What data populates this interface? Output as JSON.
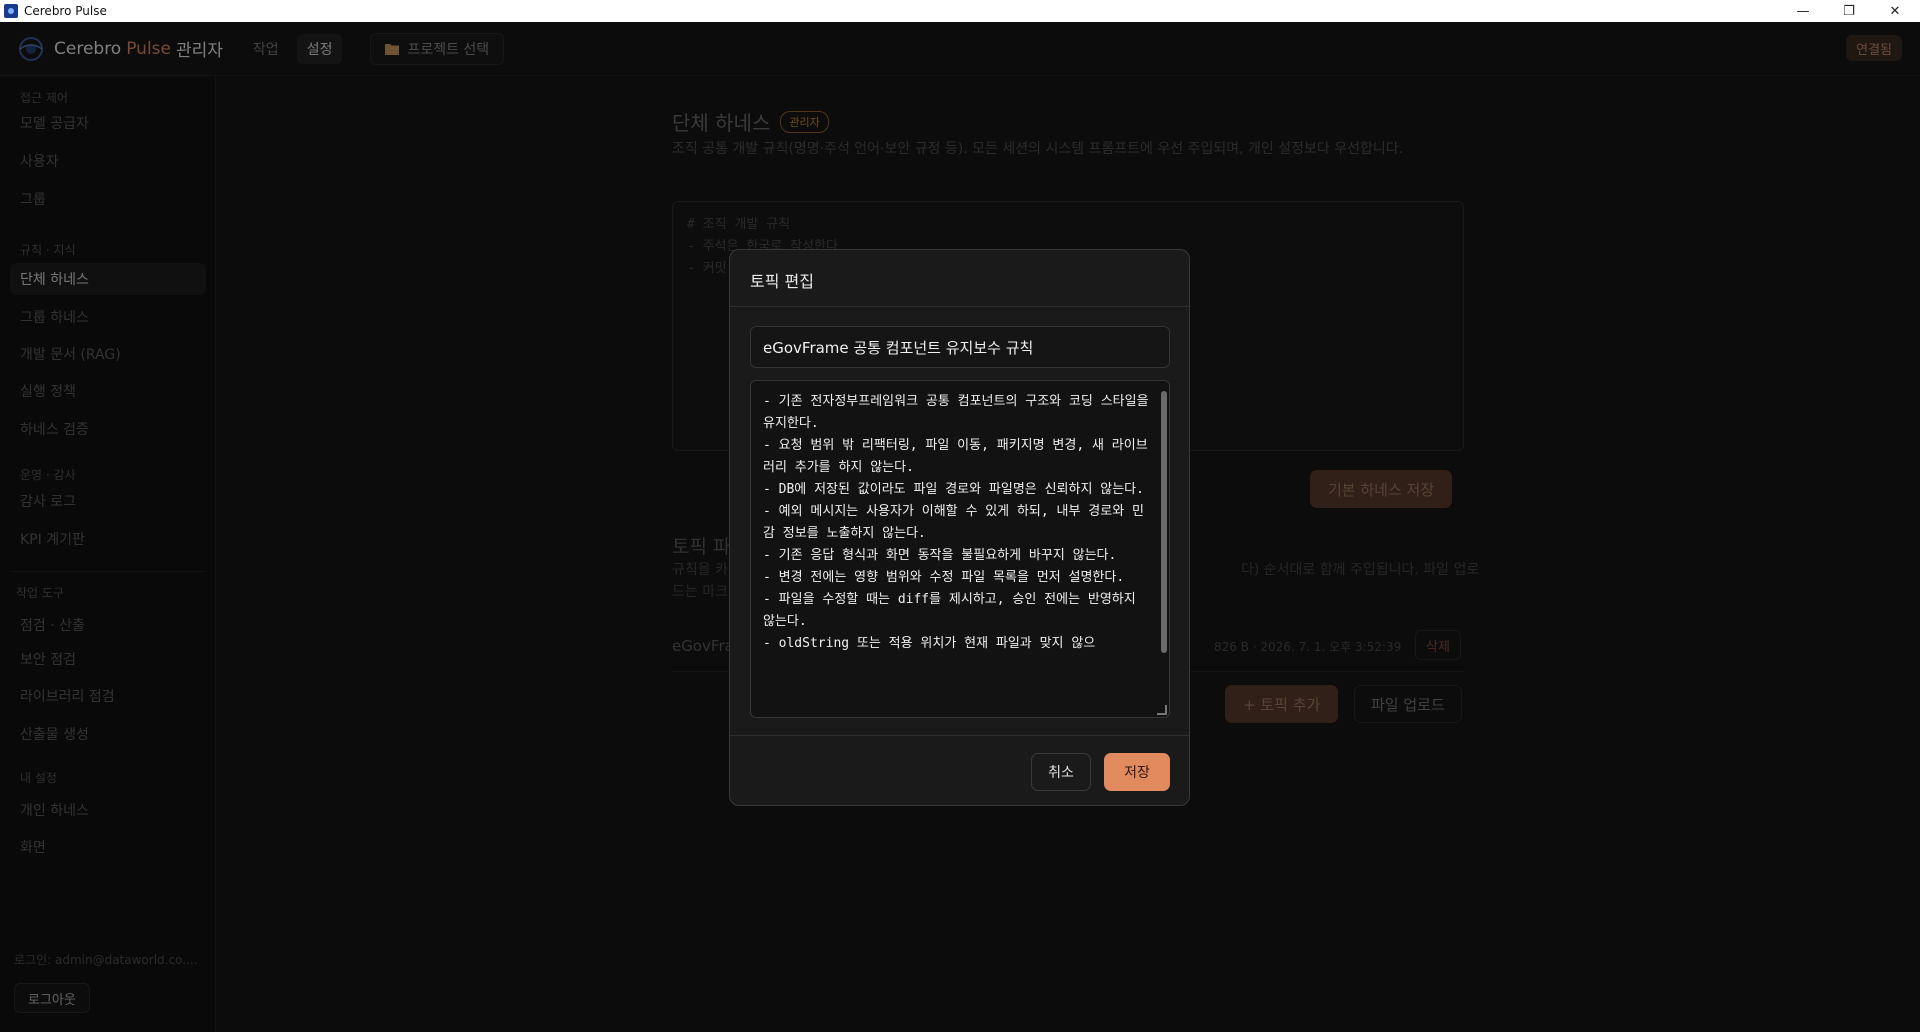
{
  "window": {
    "title": "Cerebro Pulse"
  },
  "topnav": {
    "brand_main": "Cerebro",
    "brand_accent": "Pulse",
    "brand_suffix": "관리자",
    "tab_work": "작업",
    "tab_settings": "설정",
    "project_select": "프로젝트 선택",
    "connection_status": "연결됨"
  },
  "sidebar": {
    "sections": {
      "access": "접근 제어",
      "rules": "규칙 · 지식",
      "ops": "운영 · 감사",
      "tools": "작업 도구",
      "my": "내 설정"
    },
    "items": {
      "model_providers": "모델 공급자",
      "users": "사용자",
      "groups": "그룹",
      "org_harness": "단체 하네스",
      "group_harness": "그룹 하네스",
      "dev_docs": "개발 문서 (RAG)",
      "exec_policy": "실행 정책",
      "harness_verify": "하네스 검증",
      "audit_log": "감사 로그",
      "kpi": "KPI 계기판",
      "inspect": "점검 · 산출",
      "security": "보안 점검",
      "library": "라이브러리 점검",
      "artifacts": "산출물 생성",
      "personal_harness": "개인 하네스",
      "screen": "화면"
    },
    "login": "로그인: admin@dataworld.co....",
    "logout": "로그아웃"
  },
  "main": {
    "title": "단체 하네스",
    "badge": "관리자",
    "description": "조직 공통 개발 규칙(명명·주석 언어·보안 규정 등). 모든 세션의 시스템 프롬프트에 우선 주입되며, 개인 설정보다 우선합니다.",
    "editor_lines": [
      "# 조직 개발 규칙",
      "- 주석은 한국로 작성한다",
      "- 커밋"
    ],
    "save_base": "기본 하네스 저장",
    "topics_title": "토픽 파",
    "topics_desc_1": "규칙을 카",
    "topics_desc_1b": "다) 순서대로 함께 주입됩니다. 파일 업로",
    "topics_desc_2": "드는 마크",
    "topic_row_name": "eGovFra",
    "topic_row_meta": "826 B · 2026. 7. 1. 오후 3:52:39",
    "delete": "삭제",
    "add_topic": "+ 토픽 추가",
    "upload": "파일 업로드"
  },
  "modal": {
    "title": "토픽 편집",
    "name_value": "eGovFrame 공통 컴포넌트 유지보수 규칙",
    "body": "- 기존 전자정부프레임워크 공통 컴포넌트의 구조와 코딩 스타일을 유지한다.\n- 요청 범위 밖 리팩터링, 파일 이동, 패키지명 변경, 새 라이브러리 추가를 하지 않는다.\n- DB에 저장된 값이라도 파일 경로와 파일명은 신뢰하지 않는다.\n- 예외 메시지는 사용자가 이해할 수 있게 하되, 내부 경로와 민감 정보를 노출하지 않는다.\n- 기존 응답 형식과 화면 동작을 불필요하게 바꾸지 않는다.\n- 변경 전에는 영향 범위와 수정 파일 목록을 먼저 설명한다.\n- 파일을 수정할 때는 diff를 제시하고, 승인 전에는 반영하지 않는다.\n- oldString 또는 적용 위치가 현재 파일과 맞지 않으",
    "cancel": "취소",
    "save": "저장"
  },
  "colors": {
    "accent": "#e08a5e",
    "background": "#161616",
    "modal_bg": "#1a1a1a"
  }
}
